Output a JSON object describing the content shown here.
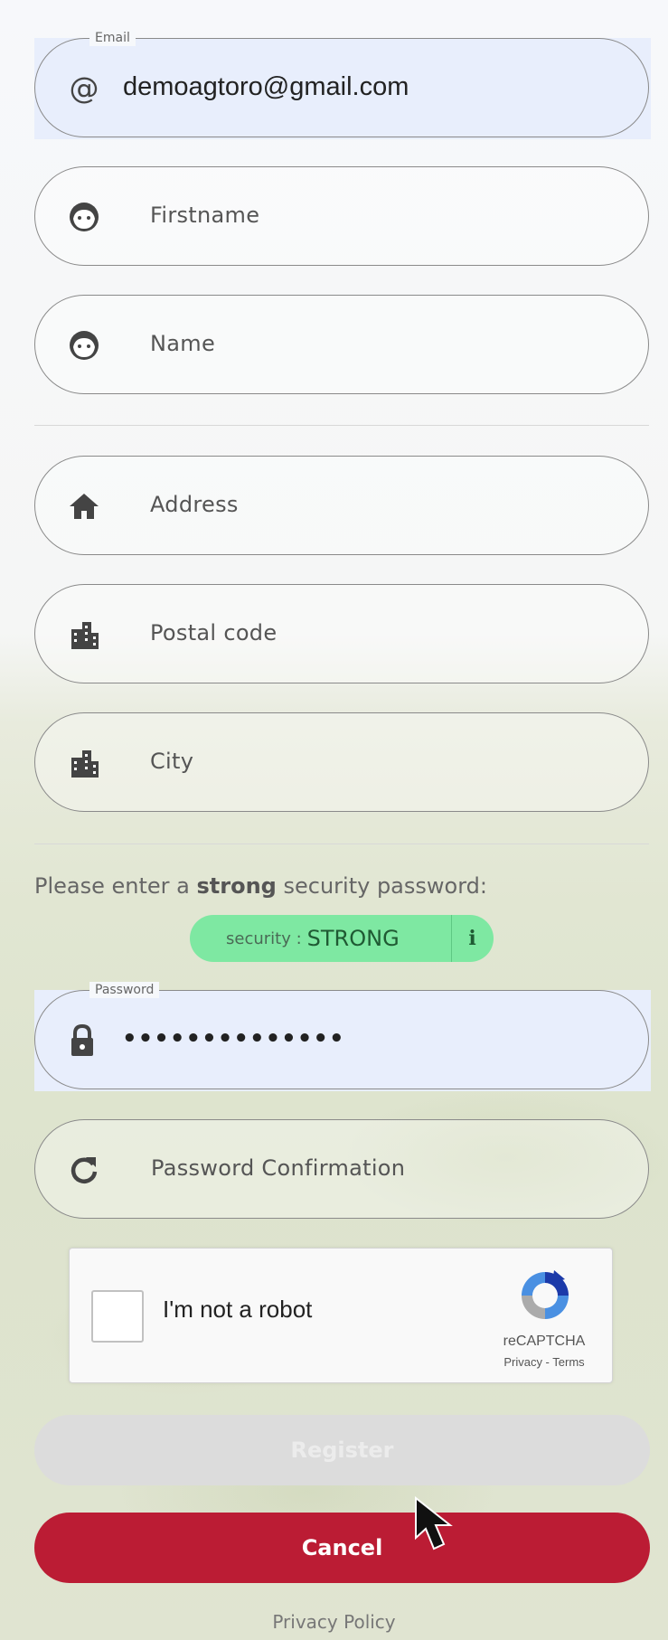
{
  "form": {
    "email": {
      "label": "Email",
      "value": "demoagtoro@gmail.com",
      "icon": "at-icon"
    },
    "firstname": {
      "placeholder": "Firstname",
      "icon": "face-icon"
    },
    "name": {
      "placeholder": "Name",
      "icon": "face-icon"
    },
    "address": {
      "placeholder": "Address",
      "icon": "home-icon"
    },
    "postal_code": {
      "placeholder": "Postal code",
      "icon": "city-icon"
    },
    "city": {
      "placeholder": "City",
      "icon": "city-icon"
    },
    "password_hint_pre": "Please enter a ",
    "password_hint_strong": "strong",
    "password_hint_post": " security password:",
    "security_badge": {
      "prefix": "security :",
      "level": "STRONG",
      "info": "i",
      "color": "#7ee8a2"
    },
    "password": {
      "label": "Password",
      "masked_value": "••••••••••••••",
      "icon": "lock-icon"
    },
    "password_confirmation": {
      "placeholder": "Password Confirmation",
      "icon": "refresh-icon"
    }
  },
  "captcha": {
    "label": "I'm not a robot",
    "brand": "reCAPTCHA",
    "terms": "Privacy - Terms",
    "checked": false
  },
  "buttons": {
    "register": {
      "label": "Register",
      "enabled": false,
      "color": "#dcdcdc"
    },
    "cancel": {
      "label": "Cancel",
      "color": "#bb1c34"
    }
  },
  "footer": {
    "privacy_policy": "Privacy Policy"
  },
  "colors": {
    "filled_field": "#e8eefc",
    "accent": "#bb1c34"
  }
}
